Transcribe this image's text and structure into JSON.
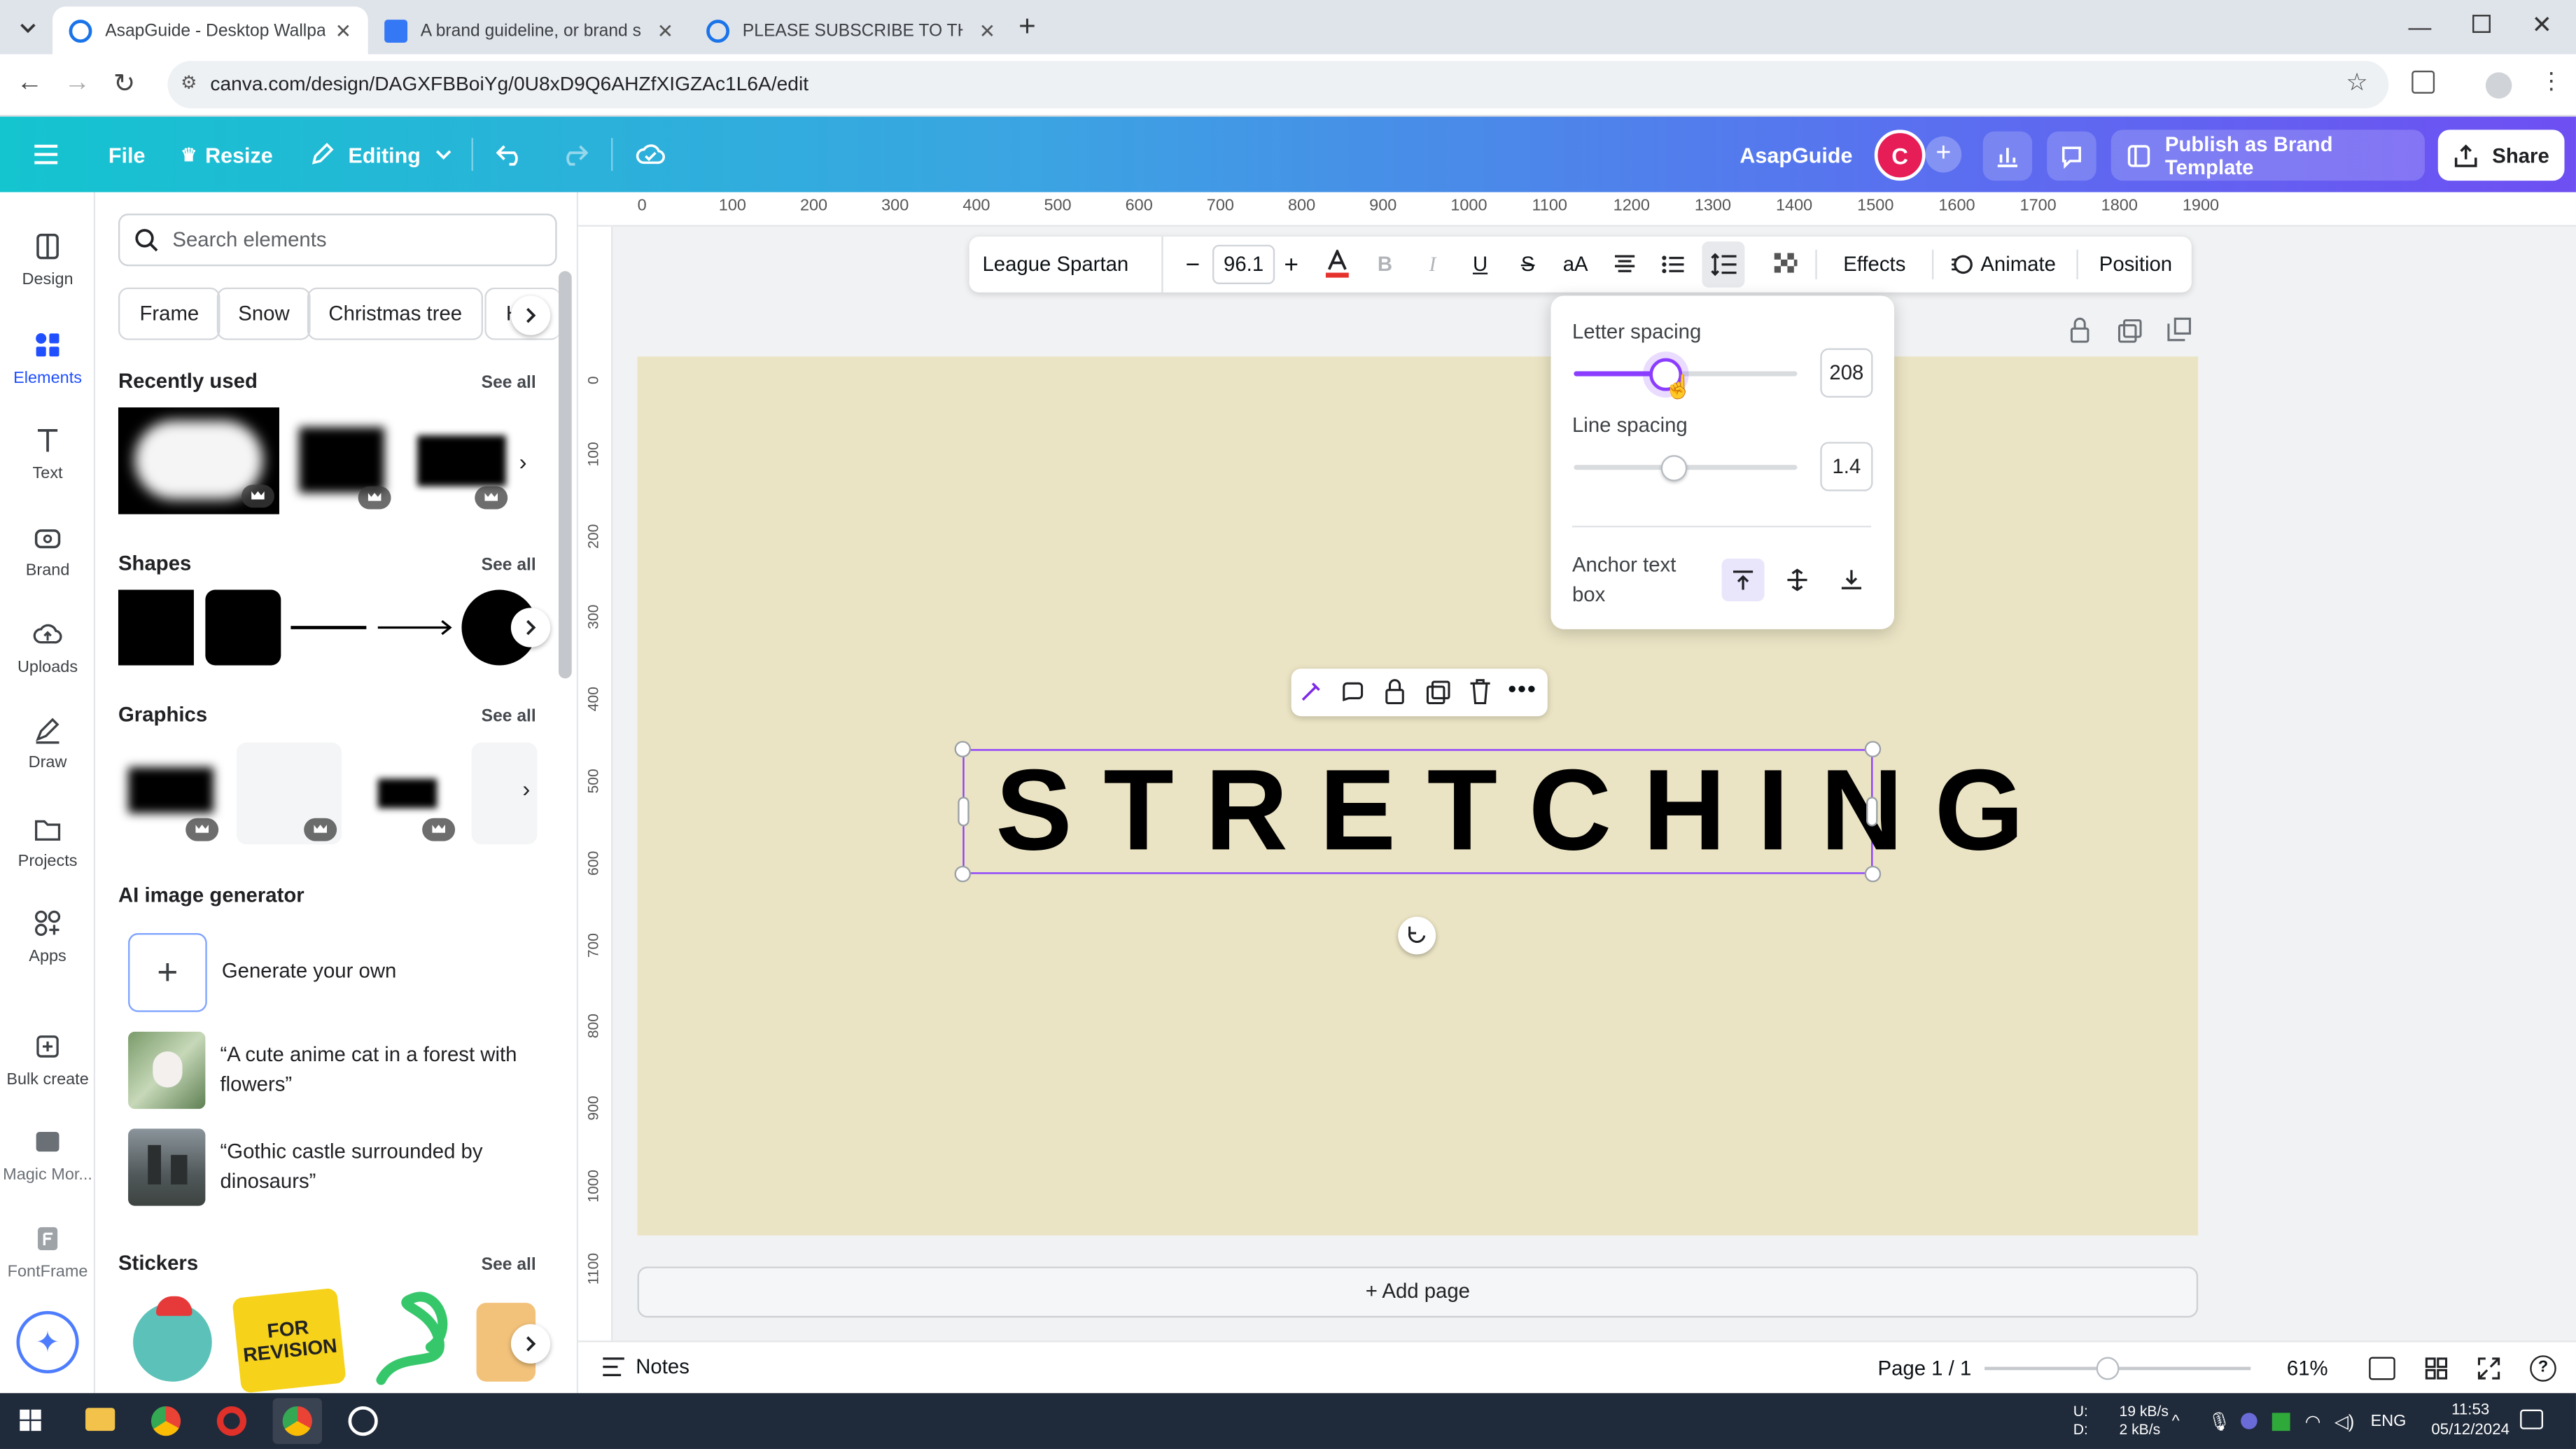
{
  "browser": {
    "tabs": [
      {
        "title": "AsapGuide - Desktop Wallpape",
        "active": true
      },
      {
        "title": "A brand guideline, or brand sty",
        "active": false
      },
      {
        "title": "PLEASE SUBSCRIBE TO THIS CH",
        "active": false
      }
    ],
    "url": "canva.com/design/DAGXFBBoiYg/0U8xD9Q6AHZfXIGZAc1L6A/edit"
  },
  "header": {
    "file": "File",
    "resize": "Resize",
    "mode": "Editing",
    "brand_name": "AsapGuide",
    "avatar_letter": "C",
    "publish": "Publish as Brand Template",
    "share": "Share"
  },
  "rail": [
    {
      "label": "Design",
      "icon": "design-icon"
    },
    {
      "label": "Elements",
      "icon": "elements-icon"
    },
    {
      "label": "Text",
      "icon": "text-icon"
    },
    {
      "label": "Brand",
      "icon": "brand-icon"
    },
    {
      "label": "Uploads",
      "icon": "uploads-icon"
    },
    {
      "label": "Draw",
      "icon": "draw-icon"
    },
    {
      "label": "Projects",
      "icon": "projects-icon"
    },
    {
      "label": "Apps",
      "icon": "apps-icon"
    },
    {
      "label": "Bulk create",
      "icon": "bulk-create-icon"
    },
    {
      "label": "Magic Mor...",
      "icon": "magic-morph-icon"
    },
    {
      "label": "FontFrame",
      "icon": "fontframe-icon"
    }
  ],
  "panel": {
    "search_placeholder": "Search elements",
    "chips": [
      "Frame",
      "Snow",
      "Christmas tree",
      "He"
    ],
    "recently_used": "Recently used",
    "shapes": "Shapes",
    "graphics": "Graphics",
    "ai_generator": "AI image generator",
    "generate_your_own": "Generate your own",
    "prompts": [
      "“A cute anime cat in a forest with flowers”",
      "“Gothic castle surrounded by dinosaurs”"
    ],
    "stickers": "Stickers",
    "see_all": "See all"
  },
  "ruler": {
    "top": [
      "0",
      "100",
      "200",
      "300",
      "400",
      "500",
      "600",
      "700",
      "800",
      "900",
      "1000",
      "1100",
      "1200",
      "1300",
      "1400",
      "1500",
      "1600",
      "1700",
      "1800",
      "1900"
    ],
    "left": [
      "0",
      "100",
      "200",
      "300",
      "400",
      "500",
      "600",
      "700",
      "800",
      "900",
      "1000",
      "1100"
    ]
  },
  "toolbar": {
    "font": "League Spartan",
    "size": "96.1",
    "effects": "Effects",
    "animate": "Animate",
    "position": "Position",
    "text_color": "#e5322d"
  },
  "spacing_panel": {
    "letter_spacing_label": "Letter spacing",
    "letter_spacing_value": "208",
    "letter_spacing_fraction": 0.41,
    "line_spacing_label": "Line spacing",
    "line_spacing_value": "1.4",
    "line_spacing_fraction": 0.45,
    "anchor_label": "Anchor text box"
  },
  "canvas": {
    "headline": "STRETCHING",
    "page_color": "#ebe4c4",
    "add_page": "+ Add page"
  },
  "bottom": {
    "notes": "Notes",
    "page": "Page 1 / 1",
    "zoom": "61%"
  },
  "taskbar": {
    "net_up": "U:",
    "net_down": "D:",
    "net_up_rate": "19 kB/s",
    "net_down_rate": "2 kB/s",
    "lang": "ENG",
    "time": "11:53",
    "date": "05/12/2024"
  }
}
